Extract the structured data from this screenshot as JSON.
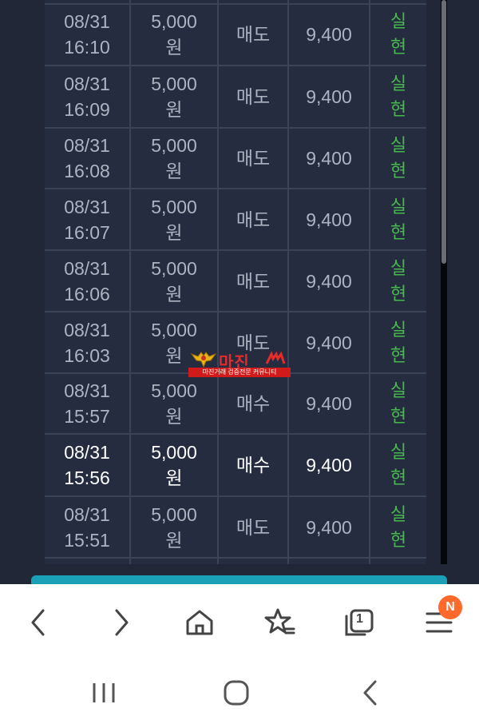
{
  "transactions": [
    {
      "date": "08/31",
      "time": "16:10",
      "amount": "5,000",
      "unit": "원",
      "type": "매도",
      "price": "9,400",
      "status1": "실",
      "status2": "현"
    },
    {
      "date": "08/31",
      "time": "16:09",
      "amount": "5,000",
      "unit": "원",
      "type": "매도",
      "price": "9,400",
      "status1": "실",
      "status2": "현"
    },
    {
      "date": "08/31",
      "time": "16:08",
      "amount": "5,000",
      "unit": "원",
      "type": "매도",
      "price": "9,400",
      "status1": "실",
      "status2": "현"
    },
    {
      "date": "08/31",
      "time": "16:07",
      "amount": "5,000",
      "unit": "원",
      "type": "매도",
      "price": "9,400",
      "status1": "실",
      "status2": "현"
    },
    {
      "date": "08/31",
      "time": "16:06",
      "amount": "5,000",
      "unit": "원",
      "type": "매도",
      "price": "9,400",
      "status1": "실",
      "status2": "현"
    },
    {
      "date": "08/31",
      "time": "16:03",
      "amount": "5,000",
      "unit": "원",
      "type": "매도",
      "price": "9,400",
      "status1": "실",
      "status2": "현"
    },
    {
      "date": "08/31",
      "time": "15:57",
      "amount": "5,000",
      "unit": "원",
      "type": "매수",
      "price": "9,400",
      "status1": "실",
      "status2": "현"
    },
    {
      "date": "08/31",
      "time": "15:56",
      "amount": "5,000",
      "unit": "원",
      "type": "매수",
      "price": "9,400",
      "status1": "실",
      "status2": "현"
    },
    {
      "date": "08/31",
      "time": "15:51",
      "amount": "5,000",
      "unit": "원",
      "type": "매도",
      "price": "9,400",
      "status1": "실",
      "status2": "현"
    }
  ],
  "watermark": {
    "title": "마진",
    "subtitle": "마진거래 검증전문 커뮤니티"
  },
  "browser": {
    "tabs_count": "1",
    "badge": "N"
  },
  "icons": {
    "back": "chevron-left-icon",
    "forward": "chevron-right-icon",
    "home": "home-icon",
    "bookmarks": "star-list-icon",
    "tabs": "tabs-icon",
    "menu": "hamburger-menu-icon"
  },
  "colors": {
    "background": "#222738",
    "table": "#252c40",
    "status_green": "#47b84d",
    "accent_teal": "#1aa1b8",
    "badge": "#ff6a2a"
  }
}
